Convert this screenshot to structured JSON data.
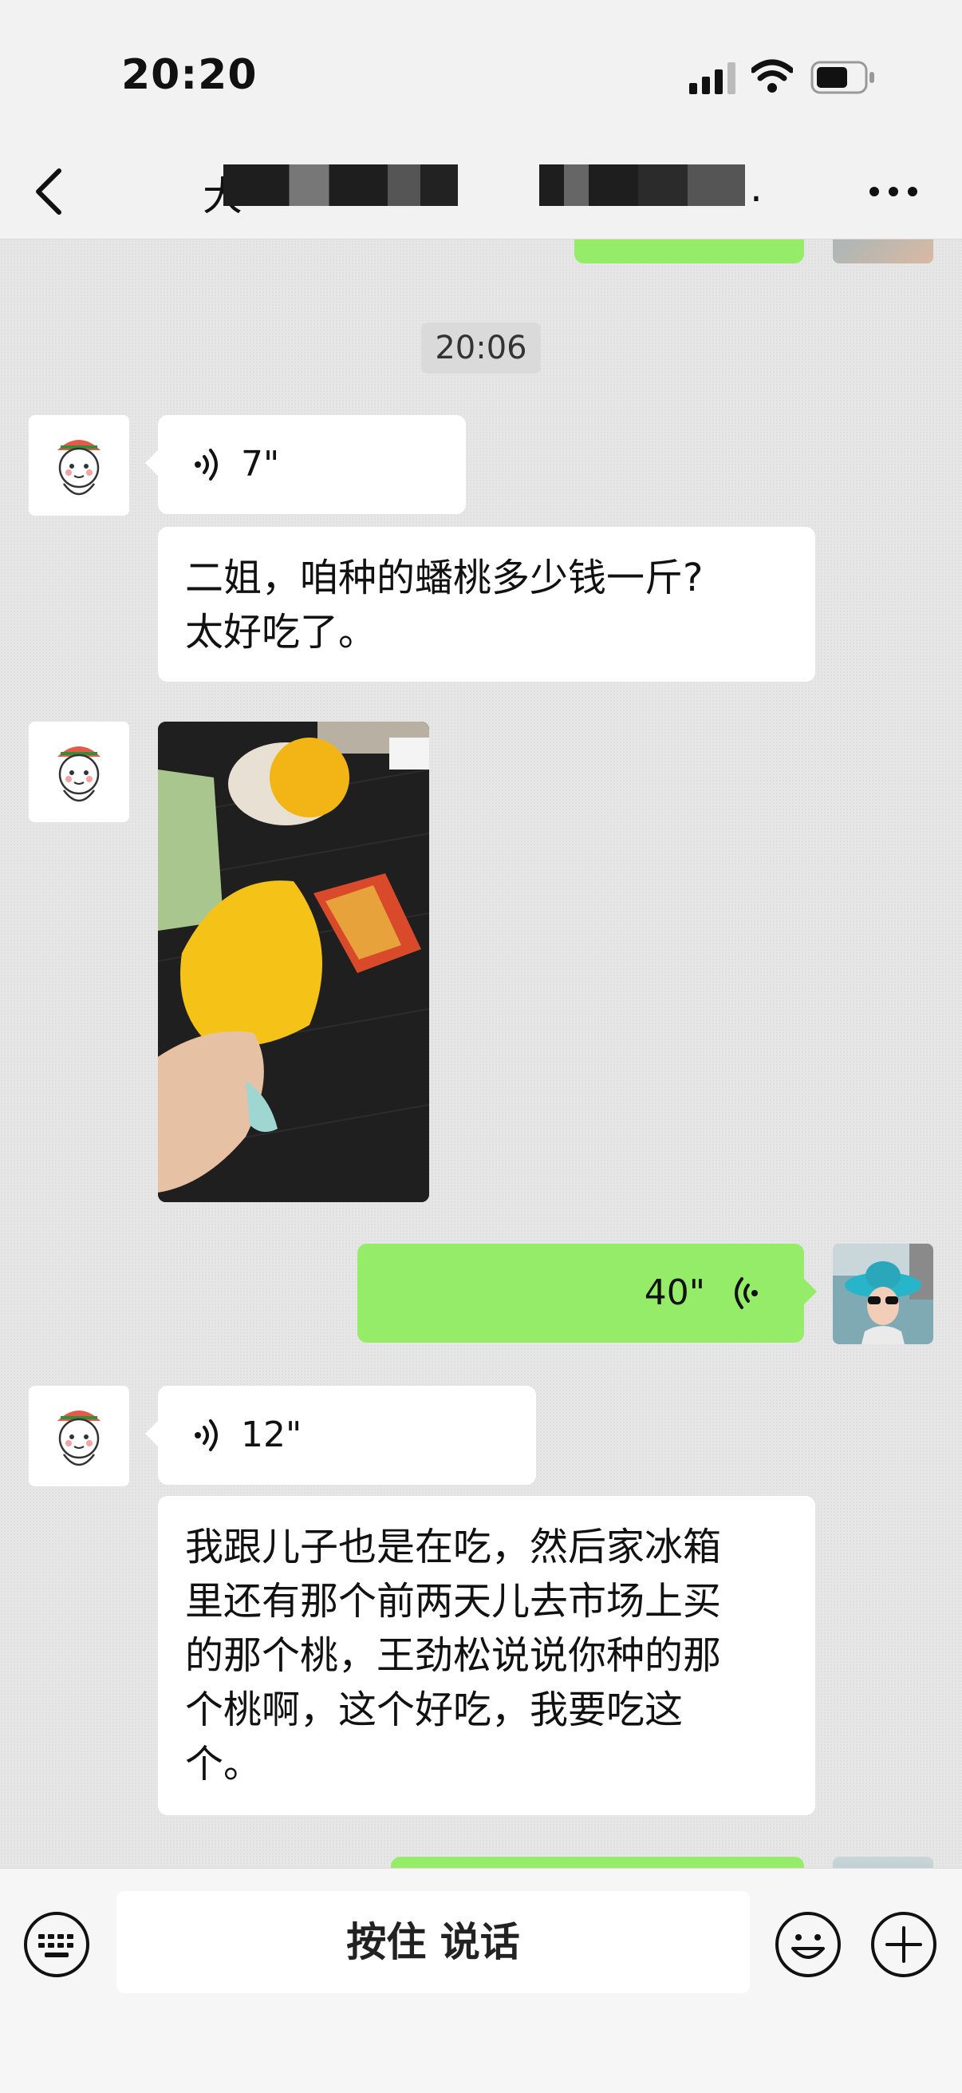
{
  "status_bar": {
    "time": "20:20"
  },
  "header": {
    "title_partial": "大",
    "title_tail": ".",
    "back_icon": "chevron-left-icon",
    "more_icon": "ellipsis-icon"
  },
  "chat": {
    "timestamp": "20:06",
    "messages": [
      {
        "from": "other",
        "type": "voice",
        "duration": "7\""
      },
      {
        "from": "other",
        "type": "text",
        "text_line1": "二姐，咱种的蟠桃多少钱一斤?",
        "text_line2": "太好吃了。"
      },
      {
        "from": "other",
        "type": "image",
        "description": "photo"
      },
      {
        "from": "me",
        "type": "voice",
        "duration": "40\""
      },
      {
        "from": "other",
        "type": "voice",
        "duration": "12\""
      },
      {
        "from": "other",
        "type": "text",
        "lines": [
          "我跟儿子也是在吃，然后家冰箱",
          "里还有那个前两天儿去市场上买",
          "的那个桃，王劲松说说你种的那",
          "个桃啊，这个好吃，我要吃这",
          "个。"
        ]
      }
    ]
  },
  "input_bar": {
    "hold_to_talk": "按住 说话",
    "keyboard_icon": "keyboard-icon",
    "emoji_icon": "emoji-icon",
    "plus_icon": "plus-circle-icon"
  },
  "colors": {
    "sent_bubble": "#95ec69",
    "received_bubble": "#ffffff",
    "chat_bg": "#e6e6e6"
  }
}
